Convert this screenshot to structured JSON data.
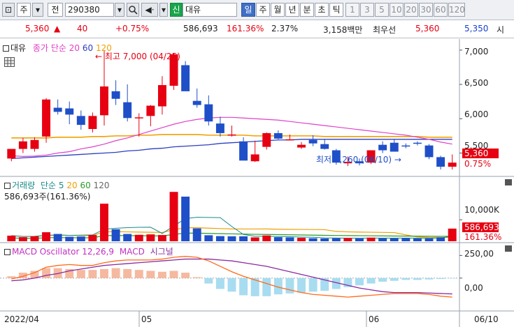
{
  "toolbar": {
    "stock_code": "290380",
    "period_type": "주",
    "compare_label": "전",
    "market_badge": "신",
    "stock_name": "대유",
    "periods": [
      "일",
      "주",
      "월",
      "년",
      "분",
      "초",
      "틱"
    ],
    "selected_period": "일",
    "intervals": [
      "1",
      "3",
      "5",
      "10",
      "20",
      "30",
      "60",
      "120"
    ]
  },
  "quote": {
    "price": "5,360",
    "change_arrow": "▲",
    "change": "40",
    "change_pct": "+0.75%",
    "volume": "586,693",
    "volume_ratio": "161.36%",
    "turnover": "2.37%",
    "amount": "3,158백만",
    "bid_label": "최우선",
    "ask": "5,360",
    "bid": "5,350",
    "trailing": "시"
  },
  "price_pane": {
    "title": "대유",
    "indicator_label": "종가 단순",
    "ma_periods": [
      "20",
      "60",
      "120"
    ],
    "high_label": "최고 7,000 (04/25)",
    "low_label": "최저 5,260 (06/10)",
    "current_price": "5,360",
    "current_change_pct": "0.75%",
    "y_ticks": [
      "7,000",
      "6,500",
      "6,000",
      "5,500"
    ]
  },
  "volume_pane": {
    "title": "거래량",
    "indicator_label": "단순",
    "ma_periods": [
      "5",
      "20",
      "60",
      "120"
    ],
    "value_label": "586,693주(161.36%)",
    "y_tick": "10,000K",
    "current_volume": "586,693",
    "current_ratio": "161.36%"
  },
  "macd_pane": {
    "title": "MACD Oscillator 12,26,9",
    "macd_label": "MACD",
    "signal_label": "시그널",
    "y_ticks": [
      "250,00",
      "0,00"
    ]
  },
  "date_axis": {
    "labels": [
      "2022/04",
      "05",
      "06",
      "06/10"
    ]
  },
  "colors": {
    "up": "#e60012",
    "down": "#1f4fc8",
    "ma20": "#e040c8",
    "ma60": "#2b3fc0",
    "ma120": "#f0a000",
    "osc": "#f5b9a0",
    "osc_neg": "#a8dcf0",
    "macd": "#ff6a1a",
    "signal": "#8a2aa0"
  },
  "chart_data": {
    "type": "candlestick",
    "candles": [
      {
        "o": 5420,
        "h": 5560,
        "l": 5380,
        "c": 5560
      },
      {
        "o": 5560,
        "h": 5720,
        "l": 5500,
        "c": 5670
      },
      {
        "o": 5560,
        "h": 5730,
        "l": 5520,
        "c": 5690
      },
      {
        "o": 5740,
        "h": 6300,
        "l": 5650,
        "c": 6280
      },
      {
        "o": 6160,
        "h": 6280,
        "l": 6060,
        "c": 6100
      },
      {
        "o": 6150,
        "h": 6250,
        "l": 5920,
        "c": 6060
      },
      {
        "o": 6040,
        "h": 6120,
        "l": 5840,
        "c": 5910
      },
      {
        "o": 5850,
        "h": 6090,
        "l": 5800,
        "c": 6040
      },
      {
        "o": 6050,
        "h": 7000,
        "l": 5900,
        "c": 6470
      },
      {
        "o": 6400,
        "h": 6560,
        "l": 6200,
        "c": 6290
      },
      {
        "o": 6240,
        "h": 6500,
        "l": 5960,
        "c": 6010
      },
      {
        "o": 6010,
        "h": 6080,
        "l": 5740,
        "c": 6020
      },
      {
        "o": 6040,
        "h": 6200,
        "l": 5890,
        "c": 6190
      },
      {
        "o": 6180,
        "h": 6620,
        "l": 6060,
        "c": 6490
      },
      {
        "o": 6480,
        "h": 6960,
        "l": 6420,
        "c": 6940
      },
      {
        "o": 6780,
        "h": 6840,
        "l": 6440,
        "c": 6400
      },
      {
        "o": 6260,
        "h": 6440,
        "l": 6160,
        "c": 6200
      },
      {
        "o": 6210,
        "h": 6340,
        "l": 5900,
        "c": 5960
      },
      {
        "o": 5930,
        "h": 6030,
        "l": 5740,
        "c": 5790
      },
      {
        "o": 5770,
        "h": 5900,
        "l": 5740,
        "c": 5770
      },
      {
        "o": 5670,
        "h": 5730,
        "l": 5400,
        "c": 5390
      },
      {
        "o": 5380,
        "h": 5680,
        "l": 5370,
        "c": 5480
      },
      {
        "o": 5590,
        "h": 5800,
        "l": 5550,
        "c": 5790
      },
      {
        "o": 5790,
        "h": 5830,
        "l": 5700,
        "c": 5710
      },
      {
        "o": 5700,
        "h": 5770,
        "l": 5690,
        "c": 5700
      },
      {
        "o": 5580,
        "h": 5660,
        "l": 5560,
        "c": 5620
      },
      {
        "o": 5690,
        "h": 5760,
        "l": 5600,
        "c": 5640
      },
      {
        "o": 5630,
        "h": 5700,
        "l": 5550,
        "c": 5560
      },
      {
        "o": 5540,
        "h": 5560,
        "l": 5330,
        "c": 5360
      },
      {
        "o": 5350,
        "h": 5450,
        "l": 5310,
        "c": 5370
      },
      {
        "o": 5380,
        "h": 5420,
        "l": 5320,
        "c": 5350
      },
      {
        "o": 5360,
        "h": 5540,
        "l": 5340,
        "c": 5540
      },
      {
        "o": 5620,
        "h": 5670,
        "l": 5500,
        "c": 5540
      },
      {
        "o": 5650,
        "h": 5700,
        "l": 5540,
        "c": 5520
      },
      {
        "o": 5610,
        "h": 5640,
        "l": 5570,
        "c": 5600
      },
      {
        "o": 5650,
        "h": 5670,
        "l": 5610,
        "c": 5640
      },
      {
        "o": 5610,
        "h": 5630,
        "l": 5410,
        "c": 5440
      },
      {
        "o": 5440,
        "h": 5460,
        "l": 5260,
        "c": 5300
      },
      {
        "o": 5300,
        "h": 5480,
        "l": 5260,
        "c": 5360
      }
    ],
    "ma20": [
      5460,
      5450,
      5455,
      5470,
      5500,
      5520,
      5560,
      5590,
      5630,
      5680,
      5720,
      5770,
      5820,
      5870,
      5920,
      5960,
      5990,
      6010,
      6020,
      6020,
      6010,
      6000,
      5990,
      5980,
      5960,
      5940,
      5920,
      5900,
      5880,
      5860,
      5840,
      5820,
      5800,
      5780,
      5760,
      5730,
      5700,
      5660,
      5630
    ],
    "ma60": [
      5420,
      5430,
      5440,
      5450,
      5460,
      5470,
      5480,
      5490,
      5500,
      5510,
      5530,
      5540,
      5560,
      5570,
      5590,
      5600,
      5610,
      5620,
      5640,
      5650,
      5660,
      5670,
      5680,
      5690,
      5690,
      5700,
      5700,
      5700,
      5700,
      5700,
      5700,
      5700,
      5700,
      5700,
      5700,
      5700,
      5700,
      5700,
      5700
    ],
    "ma120": [
      5720,
      5720,
      5720,
      5720,
      5730,
      5730,
      5730,
      5740,
      5740,
      5750,
      5750,
      5760,
      5760,
      5770,
      5770,
      5770,
      5770,
      5760,
      5760,
      5760,
      5760,
      5750,
      5750,
      5750,
      5750,
      5750,
      5750,
      5740,
      5740,
      5740,
      5740,
      5740,
      5740,
      5740,
      5740,
      5740,
      5730,
      5730,
      5730
    ],
    "price_ylim": [
      5200,
      7100
    ],
    "volume": [
      260,
      190,
      230,
      420,
      340,
      210,
      220,
      290,
      1750,
      560,
      340,
      300,
      320,
      290,
      2300,
      2080,
      600,
      280,
      240,
      230,
      230,
      180,
      270,
      190,
      180,
      160,
      140,
      130,
      140,
      150,
      140,
      170,
      140,
      130,
      150,
      130,
      140,
      180,
      590
    ],
    "volume_up": [
      true,
      true,
      true,
      true,
      false,
      false,
      false,
      true,
      true,
      false,
      false,
      true,
      true,
      true,
      true,
      false,
      false,
      false,
      false,
      false,
      false,
      true,
      true,
      false,
      false,
      true,
      false,
      false,
      false,
      true,
      false,
      true,
      false,
      false,
      false,
      false,
      false,
      false,
      true
    ],
    "volume_ylim": [
      0,
      2600
    ],
    "macd_osc": [
      20,
      60,
      80,
      110,
      110,
      100,
      90,
      90,
      100,
      110,
      100,
      90,
      80,
      70,
      80,
      60,
      10,
      -60,
      -120,
      -150,
      -190,
      -200,
      -200,
      -180,
      -170,
      -160,
      -150,
      -140,
      -120,
      -100,
      -80,
      -60,
      -40,
      -30,
      -20,
      -20,
      -15,
      -10,
      -5
    ],
    "macd_line": [
      -10,
      20,
      60,
      120,
      140,
      150,
      140,
      140,
      170,
      190,
      200,
      200,
      200,
      210,
      230,
      240,
      230,
      190,
      130,
      70,
      20,
      -20,
      -60,
      -100,
      -130,
      -160,
      -180,
      -190,
      -200,
      -210,
      -200,
      -190,
      -180,
      -170,
      -170,
      -170,
      -180,
      -200,
      -210
    ],
    "signal_line": [
      -30,
      -20,
      0,
      30,
      50,
      80,
      100,
      120,
      140,
      150,
      160,
      170,
      180,
      190,
      200,
      210,
      210,
      210,
      200,
      190,
      170,
      150,
      130,
      100,
      70,
      40,
      10,
      -20,
      -50,
      -80,
      -110,
      -130,
      -150,
      -160,
      -160,
      -160,
      -165,
      -170,
      -175
    ],
    "macd_ylim": [
      -340,
      330
    ]
  }
}
